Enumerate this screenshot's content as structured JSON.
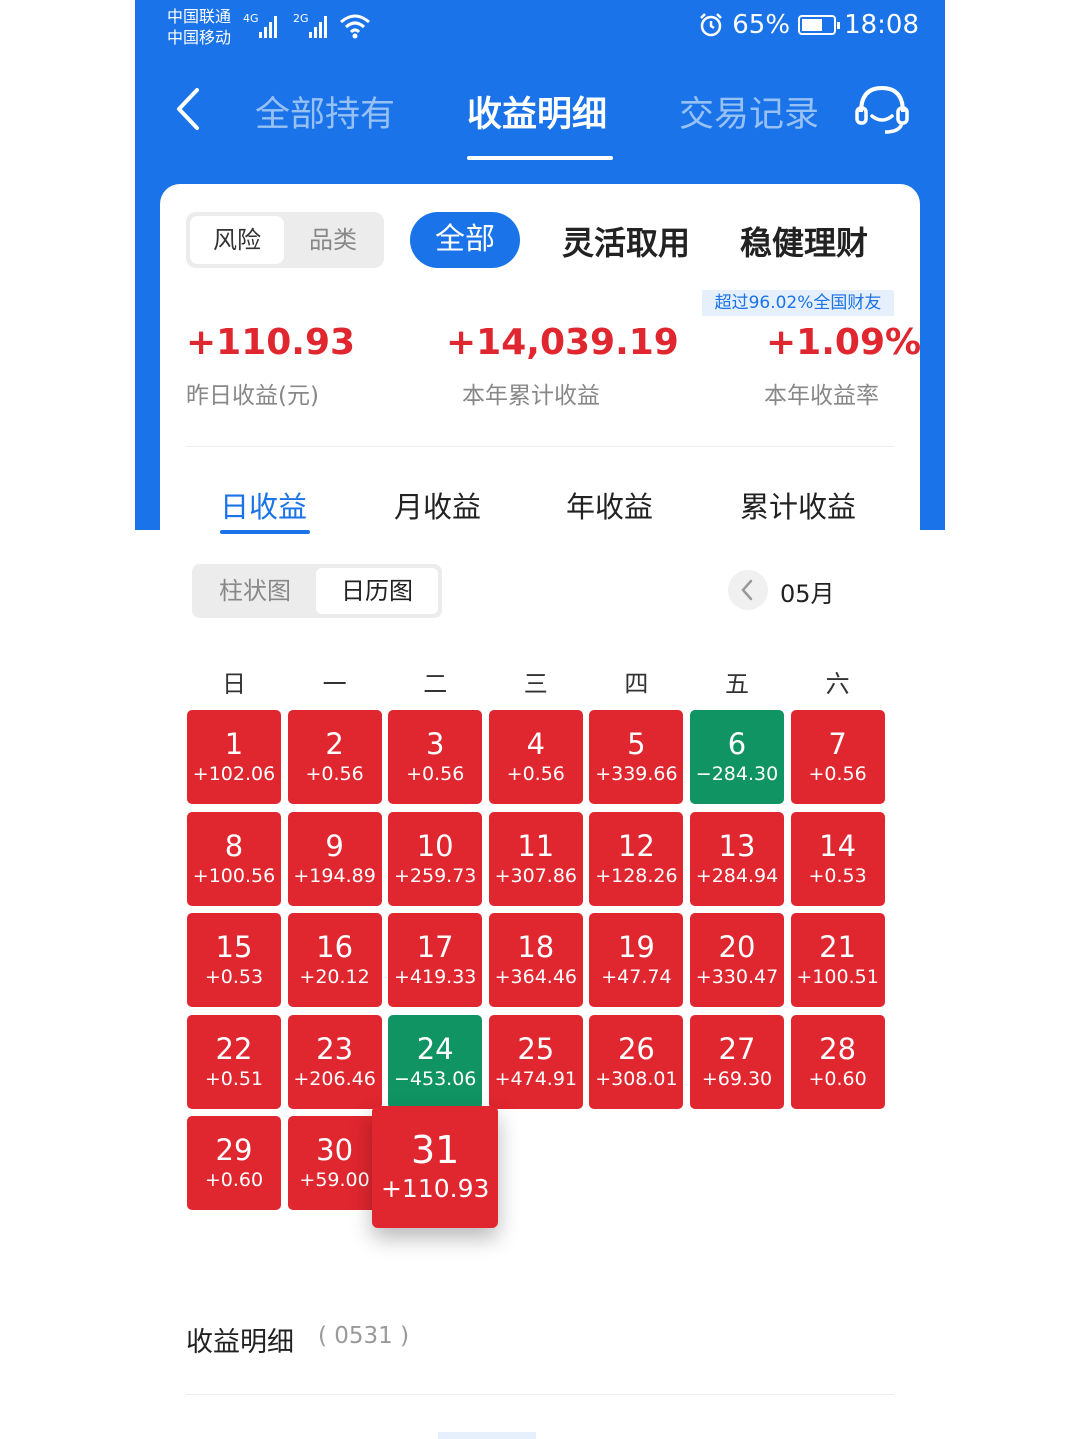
{
  "status": {
    "carrier1": "中国联通",
    "carrier2": "中国移动",
    "net1": "4G",
    "net2": "2G",
    "battery_pct": "65%",
    "battery_level": 0.65,
    "time": "18:08"
  },
  "nav": {
    "tabs": [
      "全部持有",
      "收益明细",
      "交易记录"
    ],
    "active_tab": 1
  },
  "filters": {
    "mode_seg": [
      "风险",
      "品类"
    ],
    "all_label": "全部",
    "categories": [
      "灵活取用",
      "稳健理财"
    ]
  },
  "summary": {
    "beat_badge": "超过96.02%全国财友",
    "stats": [
      {
        "value": "+110.93",
        "label": "昨日收益(元)"
      },
      {
        "value": "+14,039.19",
        "label": "本年累计收益"
      },
      {
        "value": "+1.09%",
        "label": "本年收益率"
      }
    ]
  },
  "period_tabs": [
    "日收益",
    "月收益",
    "年收益",
    "累计收益"
  ],
  "view_seg": [
    "柱状图",
    "日历图"
  ],
  "month_label": "05月",
  "weekdays": [
    "日",
    "一",
    "二",
    "三",
    "四",
    "五",
    "六"
  ],
  "calendar": [
    {
      "d": "1",
      "v": "+102.06"
    },
    {
      "d": "2",
      "v": "+0.56"
    },
    {
      "d": "3",
      "v": "+0.56"
    },
    {
      "d": "4",
      "v": "+0.56"
    },
    {
      "d": "5",
      "v": "+339.66"
    },
    {
      "d": "6",
      "v": "−284.30"
    },
    {
      "d": "7",
      "v": "+0.56"
    },
    {
      "d": "8",
      "v": "+100.56"
    },
    {
      "d": "9",
      "v": "+194.89"
    },
    {
      "d": "10",
      "v": "+259.73"
    },
    {
      "d": "11",
      "v": "+307.86"
    },
    {
      "d": "12",
      "v": "+128.26"
    },
    {
      "d": "13",
      "v": "+284.94"
    },
    {
      "d": "14",
      "v": "+0.53"
    },
    {
      "d": "15",
      "v": "+0.53"
    },
    {
      "d": "16",
      "v": "+20.12"
    },
    {
      "d": "17",
      "v": "+419.33"
    },
    {
      "d": "18",
      "v": "+364.46"
    },
    {
      "d": "19",
      "v": "+47.74"
    },
    {
      "d": "20",
      "v": "+330.47"
    },
    {
      "d": "21",
      "v": "+100.51"
    },
    {
      "d": "22",
      "v": "+0.51"
    },
    {
      "d": "23",
      "v": "+206.46"
    },
    {
      "d": "24",
      "v": "−453.06"
    },
    {
      "d": "25",
      "v": "+474.91"
    },
    {
      "d": "26",
      "v": "+308.01"
    },
    {
      "d": "27",
      "v": "+69.30"
    },
    {
      "d": "28",
      "v": "+0.60"
    },
    {
      "d": "29",
      "v": "+0.60"
    },
    {
      "d": "30",
      "v": "+59.00"
    },
    {
      "d": "31",
      "v": "+110.93"
    }
  ],
  "selected_day": "31",
  "detail": {
    "title": "收益明细",
    "code": "( 0531 )"
  },
  "colors": {
    "brand_blue": "#1a73e8",
    "gain_red": "#e0262f",
    "loss_green": "#109463"
  }
}
